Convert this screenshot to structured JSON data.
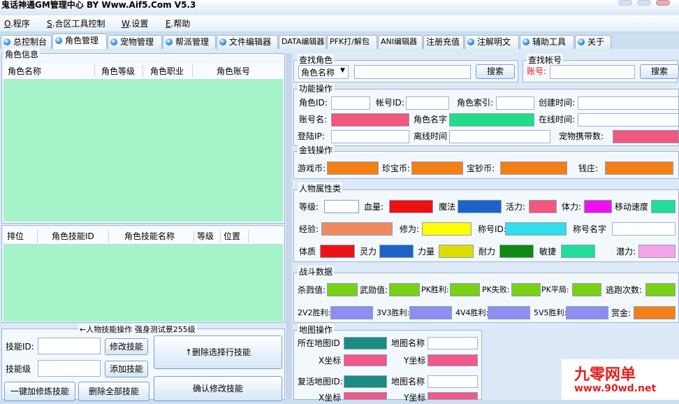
{
  "window": {
    "title": "鬼话神通GM管理中心 BY Www.Aif5.Com  V5.3"
  },
  "menu": {
    "items": [
      {
        "key": "O",
        "rest": ".程序"
      },
      {
        "key": "S",
        "rest": ".合区工具控制"
      },
      {
        "key": "W",
        "rest": ".设置"
      },
      {
        "key": "E",
        "rest": ".帮助"
      }
    ]
  },
  "tabs": [
    "总控制台",
    "角色管理",
    "宠物管理",
    "帮派管理",
    "文件编辑器",
    "DATA编辑器",
    "PFK打/解包",
    "ANI编辑器",
    "注册充值",
    "注解明文",
    "辅助工具",
    "关于"
  ],
  "role_info": {
    "title": "角色信息",
    "columns": [
      "角色名称",
      "角色等级",
      "角色职业",
      "角色账号"
    ]
  },
  "skill_list": {
    "columns": [
      "排位",
      "角色技能ID",
      "角色技能名称",
      "等级",
      "位置"
    ]
  },
  "skill_ops": {
    "title": "←人物技能操作 强身测试景255级",
    "skill_id_label": "技能ID:",
    "skill_level_label": "技能级",
    "modify_btn": "修改技能",
    "add_btn": "添加技能",
    "delete_selected_btn": "↑删除选择行技能",
    "one_click_btn": "一键加修炼技能",
    "delete_all_btn": "删除全部技能",
    "confirm_btn": "确认修改技能"
  },
  "find_role": {
    "title": "查找角色",
    "select_value": "角色名称",
    "search_btn": "搜索"
  },
  "find_account": {
    "title": "查找帐号",
    "account_label": "账号:",
    "search_btn": "搜索"
  },
  "func_ops": {
    "title": "功能操作",
    "role_id": "角色ID:",
    "account_id": "帐号ID:",
    "role_index": "角色索引:",
    "create_time": "创建时间:",
    "account_name": "账号名:",
    "role_name": "角色名字",
    "online_time": "在线时间:",
    "login_ip": "登陆IP:",
    "offline_time": "离线时间",
    "pet_carry": "宠物携带数:",
    "pet_carry_color": "#f2587e"
  },
  "money_ops": {
    "title": "金钱操作",
    "fields": [
      {
        "label": "游戏币:",
        "color": "#f57f17"
      },
      {
        "label": "珍宝币:",
        "color": "#f57f17"
      },
      {
        "label": "宝钞币:",
        "color": "#f57f17"
      },
      {
        "label": "钱庄:",
        "color": "#f57f17"
      }
    ]
  },
  "attr": {
    "title": "人物属性类",
    "row1": [
      {
        "label": "等级:",
        "color": "#ffffff"
      },
      {
        "label": "血量:",
        "color": "#ee1111"
      },
      {
        "label": "魔法",
        "color": "#1e64c8"
      },
      {
        "label": "活力:",
        "color": "#f2587e"
      },
      {
        "label": "体力:",
        "color": "#ee11ee"
      },
      {
        "label": "移动速度",
        "color": "#22dd99"
      }
    ],
    "row2": [
      {
        "label": "经验:",
        "color": "#f08a5d"
      },
      {
        "label": "修为:",
        "color": "#ffff00"
      },
      {
        "label": "称号ID:",
        "color": "#33ddee"
      },
      {
        "label": "称号名字",
        "color": "#ffffff"
      }
    ],
    "row3": [
      {
        "label": "体质",
        "color": "#ee1111"
      },
      {
        "label": "灵力",
        "color": "#1e64c8"
      },
      {
        "label": "力量",
        "color": "#dddd00"
      },
      {
        "label": "耐力",
        "color": "#118811"
      },
      {
        "label": "敏捷",
        "color": "#22dd99"
      },
      {
        "label": "潜力:",
        "color": "#f5a5e8"
      }
    ]
  },
  "battle": {
    "title": "战斗数据",
    "row1": [
      {
        "label": "杀戮值:",
        "color": "#7ad012"
      },
      {
        "label": "武勋值:",
        "color": "#7ad012"
      },
      {
        "label": "PK胜利:",
        "color": "#7ad012"
      },
      {
        "label": "PK失败:",
        "color": "#7ad012"
      },
      {
        "label": "PK平局:",
        "color": "#7ad012"
      },
      {
        "label": "逃跑次数:",
        "color": "#7ad012"
      }
    ],
    "row2": [
      {
        "label": "2V2胜利:",
        "color": "#8e8ef0"
      },
      {
        "label": "3V3胜利:",
        "color": "#8e8ef0"
      },
      {
        "label": "4V4胜利:",
        "color": "#8e8ef0"
      },
      {
        "label": "5V5胜利:",
        "color": "#8e8ef0"
      },
      {
        "label": "赏金:",
        "color": "#f57f17"
      }
    ]
  },
  "map_ops": {
    "title": "地图操作",
    "cur_map_id": "所在地图ID",
    "map_name": "地图名称",
    "x": "X坐标",
    "y": "Y坐标",
    "revive_map_id": "复活地图ID:",
    "map_name2": "地图名称",
    "x2": "X坐标",
    "y2": "Y坐标"
  },
  "watermark": {
    "line1": "九零网单",
    "line2": "www.90wd.net"
  },
  "colors": {
    "accent_green": "#a5f3c9",
    "teal": "#1c8c82",
    "pink": "#f2588a",
    "window_bg": "#ccdff1"
  }
}
